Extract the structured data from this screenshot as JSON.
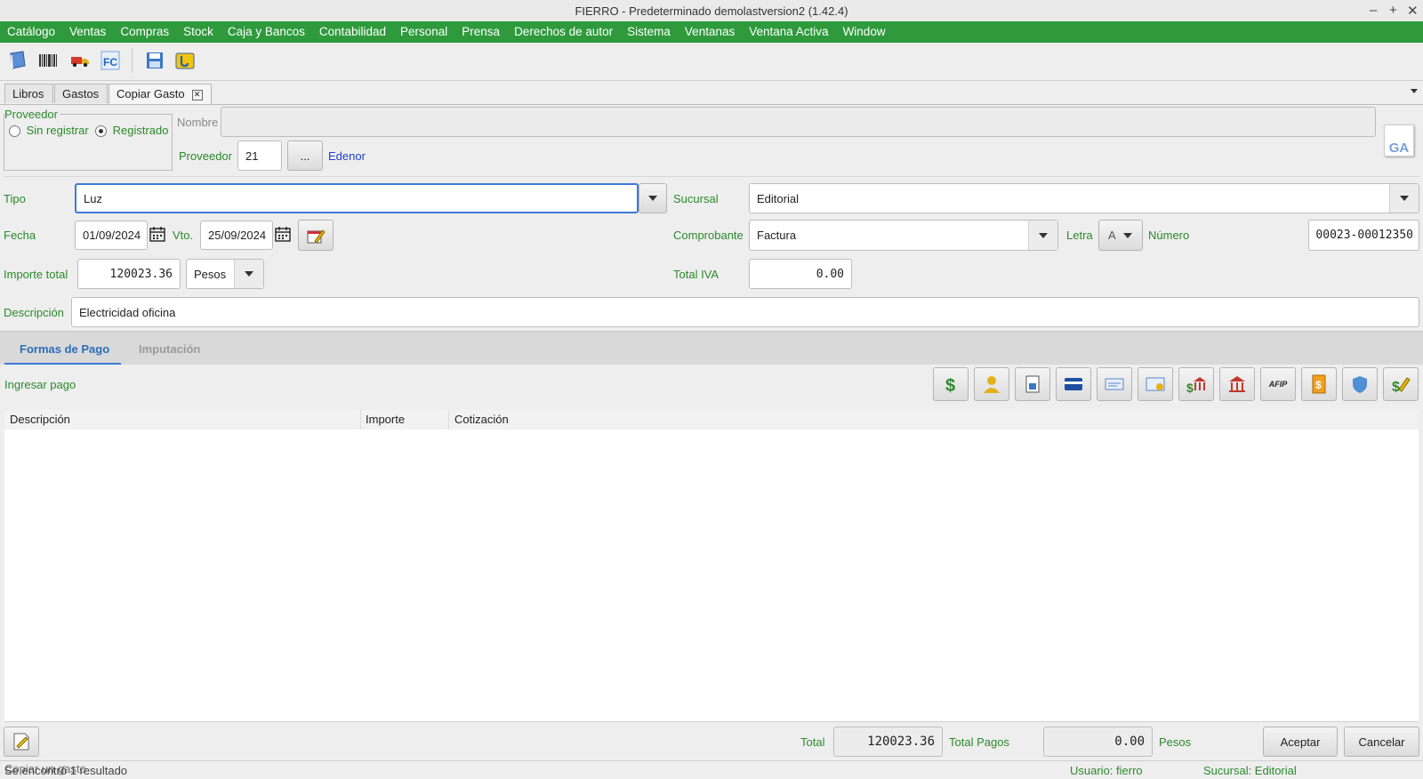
{
  "window": {
    "title": "FIERRO - Predeterminado demolastversion2 (1.42.4)",
    "minimize": "–",
    "maximize": "+",
    "close": "✕"
  },
  "menu": [
    "Catálogo",
    "Ventas",
    "Compras",
    "Stock",
    "Caja y Bancos",
    "Contabilidad",
    "Personal",
    "Prensa",
    "Derechos de autor",
    "Sistema",
    "Ventanas",
    "Ventana Activa",
    "Window"
  ],
  "toolbar_icons": [
    "book-icon",
    "barcode-icon",
    "truck-icon",
    "fc-icon",
    "save-icon",
    "wallet-icon"
  ],
  "tabs": [
    {
      "label": "Libros"
    },
    {
      "label": "Gastos"
    },
    {
      "label": "Copiar Gasto",
      "active": true,
      "close": "✕"
    }
  ],
  "proveedor": {
    "group_label": "Proveedor",
    "sin_registrar": "Sin registrar",
    "registrado": "Registrado",
    "nombre_label": "Nombre",
    "nombre_value": "",
    "proveedor_label": "Proveedor",
    "proveedor_id": "21",
    "lookup_btn": "...",
    "proveedor_name": "Edenor",
    "badge": "GA"
  },
  "form": {
    "tipo_label": "Tipo",
    "tipo_value": "Luz",
    "sucursal_label": "Sucursal",
    "sucursal_value": "Editorial",
    "fecha_label": "Fecha",
    "fecha_value": "01/09/2024",
    "vto_label": "Vto.",
    "vto_value": "25/09/2024",
    "comprobante_label": "Comprobante",
    "comprobante_value": "Factura",
    "letra_label": "Letra",
    "letra_value": "A",
    "numero_label": "Número",
    "numero_value": "00023-00012350",
    "importe_label": "Importe total",
    "importe_value": "120023.36",
    "moneda_value": "Pesos",
    "iva_label": "Total IVA",
    "iva_value": "0.00",
    "descripcion_label": "Descripción",
    "descripcion_value": "Electricidad oficina"
  },
  "subtabs": [
    "Formas de Pago",
    "Imputación"
  ],
  "pagos": {
    "ingresar_label": "Ingresar pago",
    "buttons": [
      "cash-icon",
      "person-icon",
      "checks-icon",
      "credit-card-icon",
      "bank-transfer-icon",
      "card-payment-icon",
      "bank-deposit-icon",
      "bank-icon",
      "afip-icon",
      "voucher-icon",
      "shield-icon",
      "payment-edit-icon"
    ],
    "afip_text": "AFIP",
    "columns": [
      "Descripción",
      "Importe",
      "Cotización"
    ]
  },
  "footer": {
    "total_label": "Total",
    "total_value": "120023.36",
    "pagos_label": "Total Pagos",
    "pagos_value": "0.00",
    "moneda": "Pesos",
    "aceptar": "Aceptar",
    "cancelar": "Cancelar"
  },
  "status": {
    "text": "Copiar un gasto",
    "overlap": "Se encontró 1 resultado",
    "usuario": "Usuario: fierro",
    "sucursal": "Sucursal: Editorial"
  }
}
